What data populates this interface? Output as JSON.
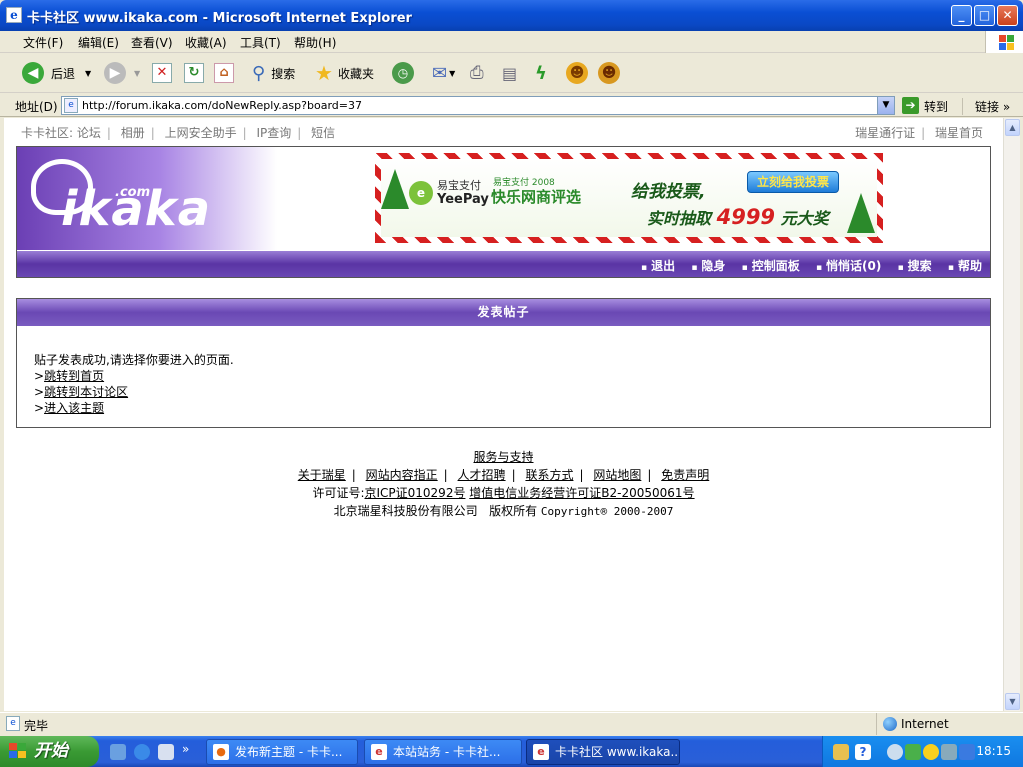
{
  "window": {
    "title": "卡卡社区 www.ikaka.com - Microsoft Internet Explorer",
    "min": "_",
    "max": "□",
    "close": "✕"
  },
  "menu": [
    "文件(F)",
    "编辑(E)",
    "查看(V)",
    "收藏(A)",
    "工具(T)",
    "帮助(H)"
  ],
  "toolbar": {
    "back": "后退",
    "search": "搜索",
    "favorites": "收藏夹"
  },
  "address": {
    "label": "地址(D)",
    "url": "http://forum.ikaka.com/doNewReply.asp?board=37",
    "go": "转到",
    "links": "链接"
  },
  "page": {
    "topnav_left": [
      "卡卡社区: 论坛",
      "相册",
      "上网安全助手",
      "IP查询",
      "短信"
    ],
    "topnav_right": [
      "瑞星通行证",
      "瑞星首页"
    ],
    "logo_text": "ikaka",
    "logo_com": ".com",
    "banner": {
      "brand": "易宝支付",
      "brand_en": "YeePay",
      "small": "易宝支付 2008",
      "event": "快乐网商评选",
      "vote": "给我投票,",
      "lottery_pre": "实时抽取",
      "lottery_num": "4999",
      "lottery_post": "元大奖",
      "button": "立刻给我投票"
    },
    "navbar": [
      "退出",
      "隐身",
      "控制面板",
      "悄悄话(0)",
      "搜索",
      "帮助"
    ],
    "post_header": "发表帖子",
    "post_msg": "贴子发表成功,请选择你要进入的页面.",
    "post_links": [
      "跳转到首页",
      "跳转到本讨论区",
      "进入该主题"
    ],
    "footer": {
      "service": "服务与支持",
      "links": [
        "关于瑞星",
        "网站内容指正",
        "人才招聘",
        "联系方式",
        "网站地图",
        "免责声明"
      ],
      "license_label": "许可证号:",
      "icp": "京ICP证010292号",
      "license2": "增值电信业务经营许可证B2-20050061号",
      "company": "北京瑞星科技股份有限公司",
      "rights": "版权所有",
      "copyright": "Copyright® 2000-2007"
    }
  },
  "status": {
    "text": "完毕",
    "zone": "Internet"
  },
  "taskbar": {
    "start": "开始",
    "tasks": [
      "发布新主题 - 卡卡...",
      "本站站务 - 卡卡社...",
      "卡卡社区 www.ikaka..."
    ],
    "clock": "18:15"
  }
}
